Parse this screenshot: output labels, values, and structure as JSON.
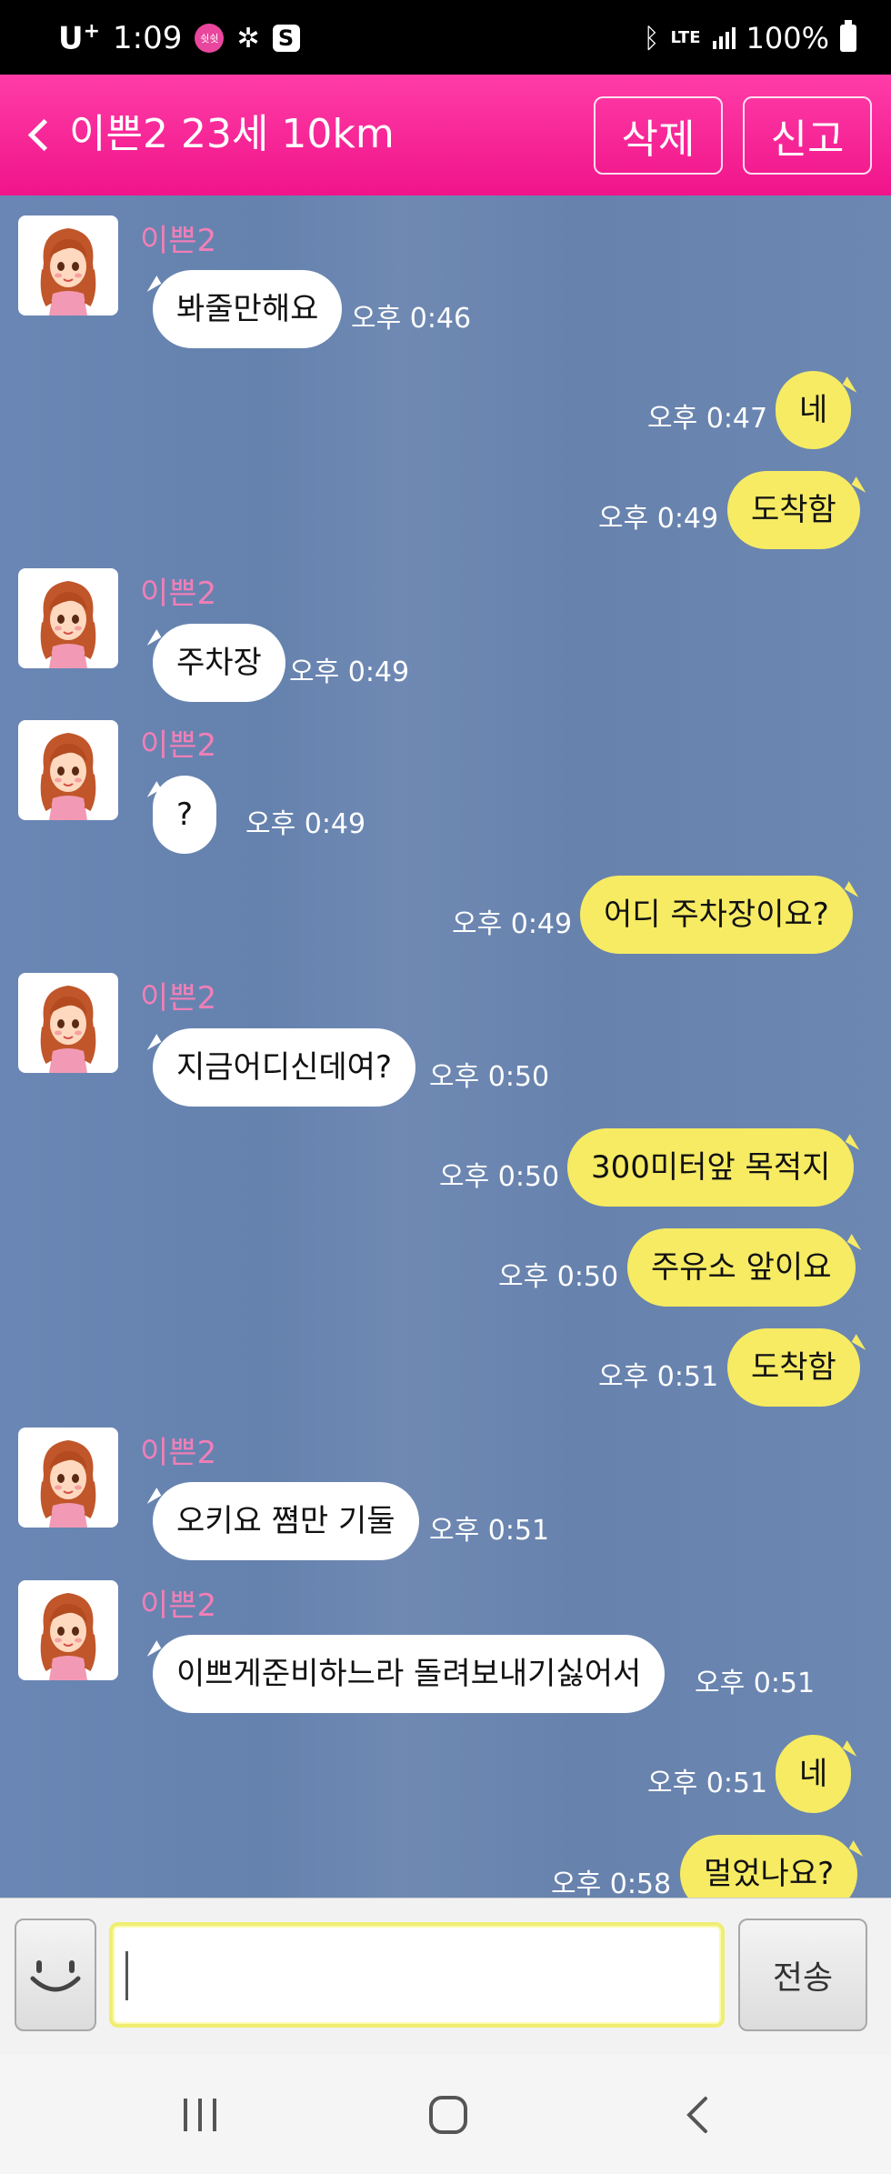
{
  "status_bar": {
    "carrier": "U",
    "carrier_sup": "+",
    "time": "1:09",
    "badge": "쉿쉿",
    "network": "LTE",
    "battery": "100%"
  },
  "header": {
    "title": "이쁜2 23세 10km",
    "delete_label": "삭제",
    "report_label": "신고",
    "color": "#f0148a"
  },
  "messages": [
    {
      "dir": "in",
      "sender": "이쁜2",
      "text": "봐줄만해요",
      "time": "오후 0:46"
    },
    {
      "dir": "out",
      "text": "네",
      "time": "오후 0:47"
    },
    {
      "dir": "out",
      "text": "도착함",
      "time": "오후 0:49"
    },
    {
      "dir": "in",
      "sender": "이쁜2",
      "text": "주차장",
      "time": "오후 0:49"
    },
    {
      "dir": "in",
      "sender": "이쁜2",
      "text": "?",
      "time": "오후 0:49"
    },
    {
      "dir": "out",
      "text": "어디 주차장이요?",
      "time": "오후 0:49"
    },
    {
      "dir": "in",
      "sender": "이쁜2",
      "text": "지금어디신데여?",
      "time": "오후 0:50"
    },
    {
      "dir": "out",
      "text": "300미터앞 목적지",
      "time": "오후 0:50"
    },
    {
      "dir": "out",
      "text": "주유소 앞이요",
      "time": "오후 0:50"
    },
    {
      "dir": "out",
      "text": "도착함",
      "time": "오후 0:51"
    },
    {
      "dir": "in",
      "sender": "이쁜2",
      "text": "오키요 쪔만 기둘",
      "time": "오후 0:51"
    },
    {
      "dir": "in",
      "sender": "이쁜2",
      "text": "이쁘게준비하느라 돌려보내기싫어서",
      "time": "오후 0:51"
    },
    {
      "dir": "out",
      "text": "네",
      "time": "오후 0:51"
    },
    {
      "dir": "out",
      "text": "멀었나요?",
      "time": "오후 0:58"
    }
  ],
  "input": {
    "value": "",
    "send_label": "전송"
  },
  "colors": {
    "chat_bg": "#6b86b2",
    "outgoing_bubble": "#f6eb63",
    "incoming_bubble": "#ffffff",
    "sender_name": "#f07fb7"
  }
}
